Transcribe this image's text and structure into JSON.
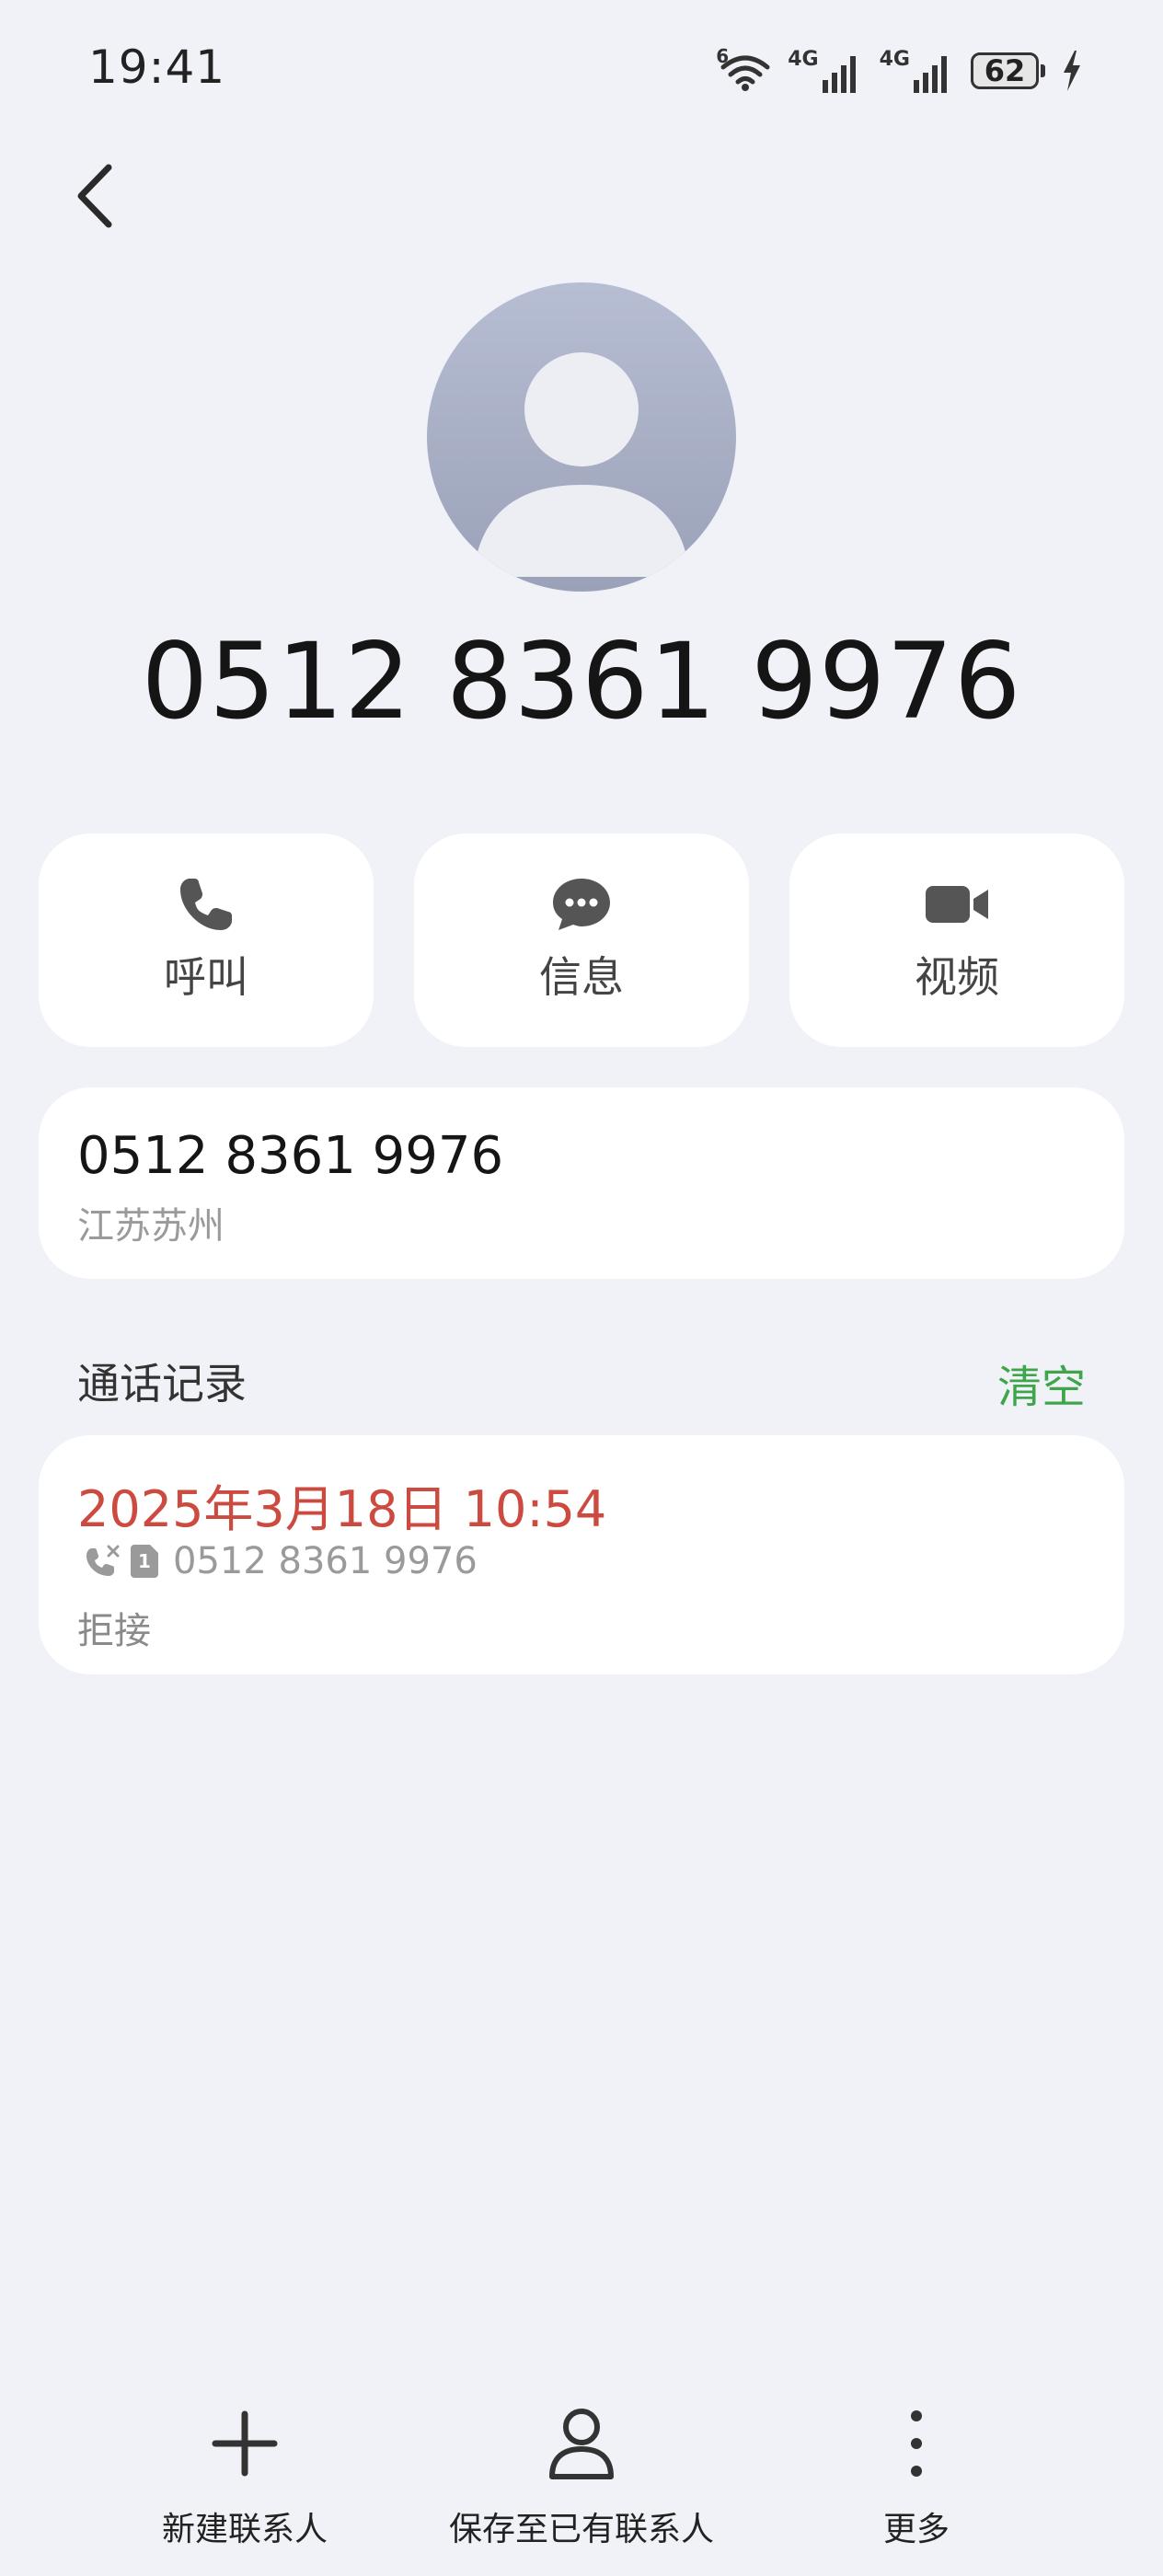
{
  "status_bar": {
    "time": "19:41",
    "wifi_badge": "6",
    "sim1_label": "4G",
    "sim2_label": "4G",
    "battery": "62"
  },
  "contact": {
    "number_display": "0512 8361 9976"
  },
  "actions": [
    {
      "label": "呼叫",
      "icon": "phone-icon"
    },
    {
      "label": "信息",
      "icon": "message-icon"
    },
    {
      "label": "视频",
      "icon": "video-icon"
    }
  ],
  "info": {
    "number": "0512 8361 9976",
    "location": "江苏苏州"
  },
  "call_log": {
    "title": "通话记录",
    "clear_label": "清空",
    "entries": [
      {
        "datetime": "2025年3月18日 10:54",
        "number": "0512 8361 9976",
        "sim": "1",
        "status": "拒接"
      }
    ]
  },
  "bottom_bar": {
    "new_contact": "新建联系人",
    "save_existing": "保存至已有联系人",
    "more": "更多"
  },
  "colors": {
    "background": "#f0f2f7",
    "accent_green": "#3fa54a",
    "missed_red": "#cc4a3f"
  }
}
